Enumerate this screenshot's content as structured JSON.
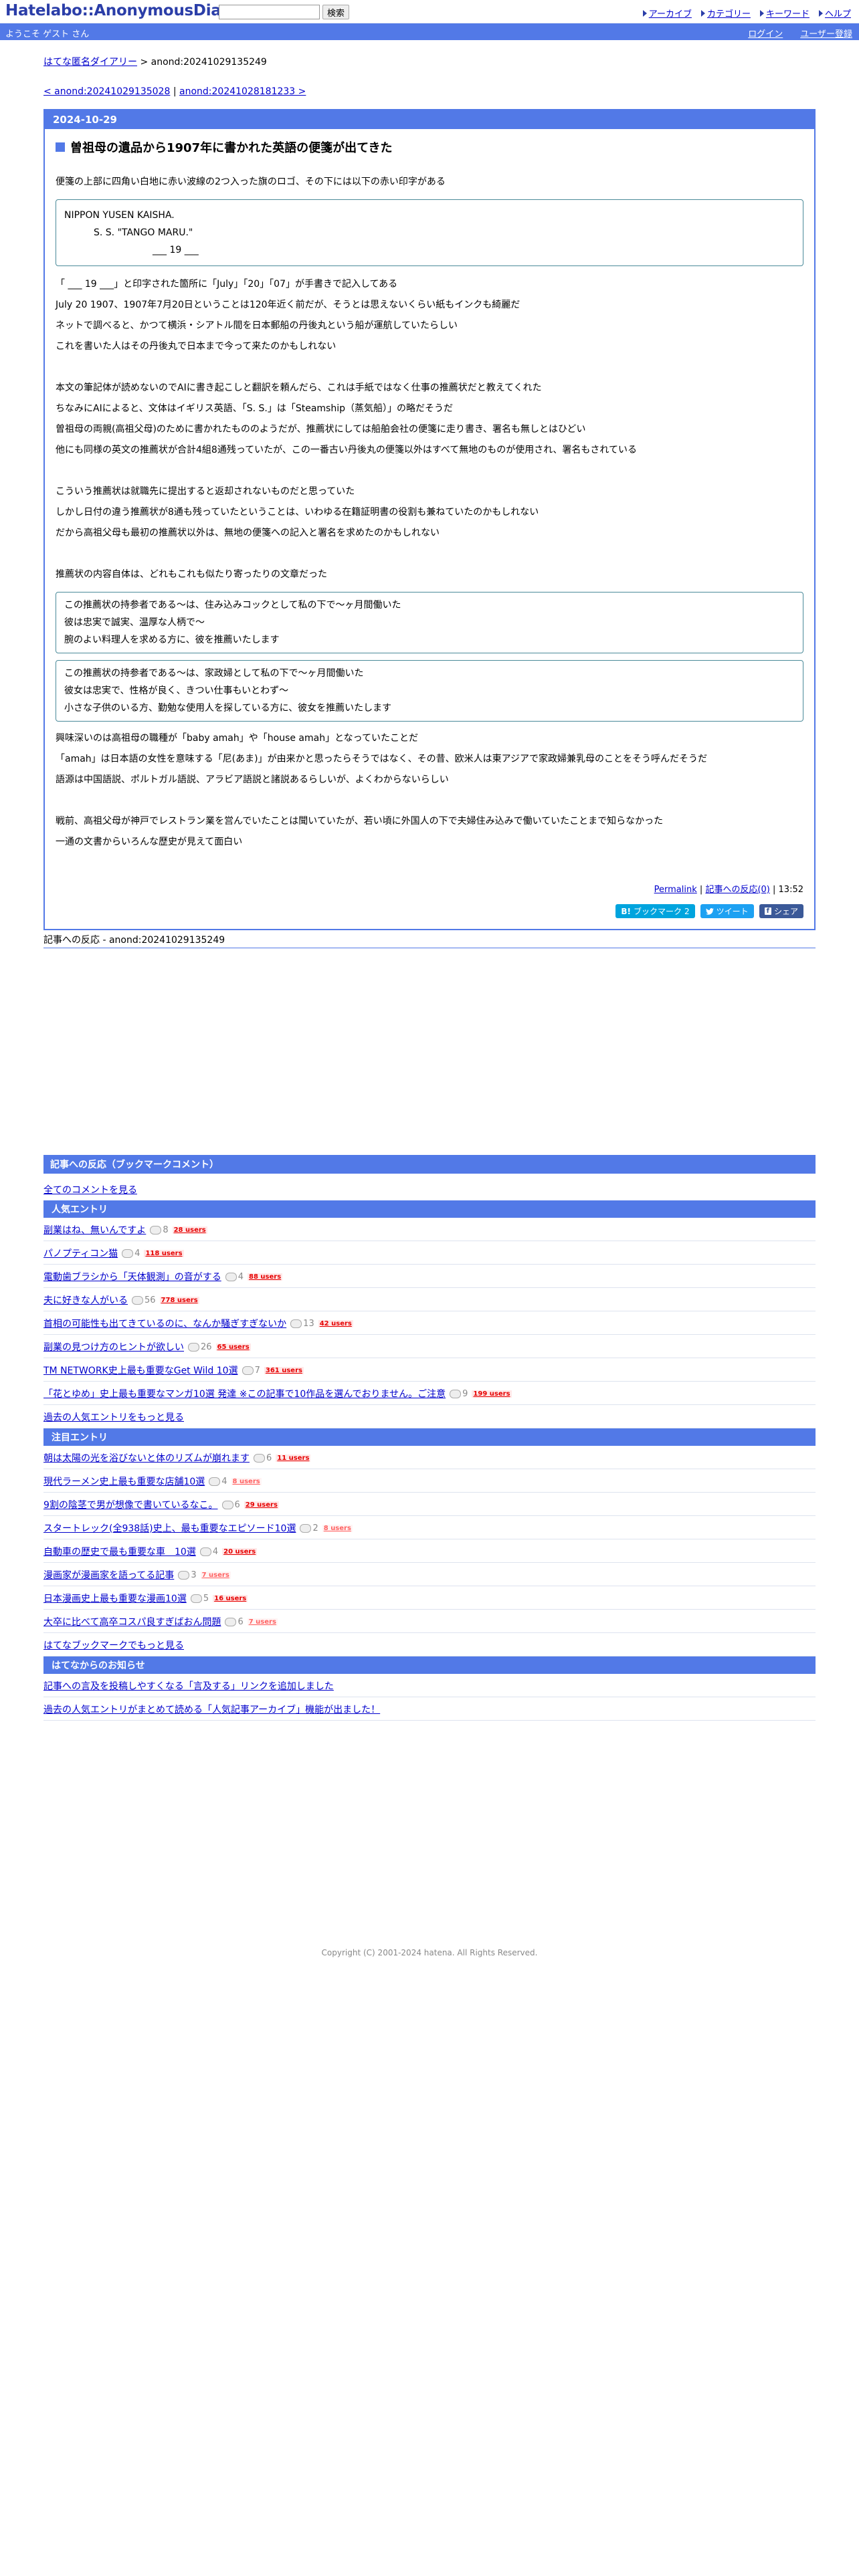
{
  "header": {
    "logo": "Hatelabo::AnonymousDiary",
    "search_placeholder": "",
    "search_button": "検索",
    "nav": [
      "アーカイブ",
      "カテゴリー",
      "キーワード",
      "ヘルプ"
    ]
  },
  "bar": {
    "welcome": "ようこそ ゲスト さん",
    "login": "ログイン",
    "register": "ユーザー登録"
  },
  "breadcrumb": {
    "home": "はてな匿名ダイアリー",
    "sep": " > ",
    "current": "anond:20241029135249"
  },
  "prevnext": {
    "prev": "< anond:20241029135028",
    "sep": " | ",
    "next": "anond:20241028181233 >"
  },
  "entry": {
    "date": "2024-10-29",
    "title": "曽祖母の遺品から1907年に書かれた英語の便箋が出てきた",
    "intro": "便箋の上部に四角い白地に赤い波線の2つ入った旗のロゴ、その下には以下の赤い印字がある",
    "printed": [
      "NIPPON YUSEN KAISHA.",
      "S. S. \"TANGO MARU.\"",
      "___ 19 ___"
    ],
    "p1": [
      "「 ___ 19 ___」と印字された箇所に「July」「20」「07」が手書きで記入してある",
      "July 20 1907、1907年7月20日ということは120年近く前だが、そうとは思えないくらい紙もインクも綺麗だ",
      "ネットで調べると、かつて横浜・シアトル間を日本郵船の丹後丸という船が運航していたらしい",
      "これを書いた人はその丹後丸で日本まで今って来たのかもしれない"
    ],
    "p2": [
      "本文の筆記体が読めないのでAIに書き起こしと翻訳を頼んだら、これは手紙ではなく仕事の推薦状だと教えてくれた",
      "ちなみにAIによると、文体はイギリス英語、「S. S.」は「Steamship（蒸気船）」の略だそうだ",
      "曽祖母の両親(高祖父母)のために書かれたもののようだが、推薦状にしては船舶会社の便箋に走り書き、署名も無しとはひどい",
      "他にも同様の英文の推薦状が合計4組8通残っていたが、この一番古い丹後丸の便箋以外はすべて無地のものが使用され、署名もされている"
    ],
    "p3": [
      "こういう推薦状は就職先に提出すると返却されないものだと思っていた",
      "しかし日付の違う推薦状が8通も残っていたということは、いわゆる在籍証明書の役割も兼ねていたのかもしれない",
      "だから高祖父母も最初の推薦状以外は、無地の便箋への記入と署名を求めたのかもしれない"
    ],
    "p4": "推薦状の内容自体は、どれもこれも似たり寄ったりの文章だった",
    "quote1": [
      "この推薦状の持参者である〜は、住み込みコックとして私の下で〜ヶ月間働いた",
      "彼は忠実で誠実、温厚な人柄で〜",
      "腕のよい料理人を求める方に、彼を推薦いたします"
    ],
    "quote2": [
      "この推薦状の持参者である〜は、家政婦として私の下で〜ヶ月間働いた",
      "彼女は忠実で、性格が良く、きつい仕事もいとわず〜",
      "小さな子供のいる方、勤勉な使用人を探している方に、彼女を推薦いたします"
    ],
    "p5": [
      "興味深いのは高祖母の職種が「baby amah」や「house amah」となっていたことだ",
      "「amah」は日本語の女性を意味する「尼(あま)」が由来かと思ったらそうではなく、その昔、欧米人は東アジアで家政婦兼乳母のことをそう呼んだそうだ",
      "語源は中国語説、ポルトガル語説、アラビア語説と諸説あるらしいが、よくわからないらしい"
    ],
    "p6": [
      "戦前、高祖父母が神戸でレストラン業を営んでいたことは聞いていたが、若い頃に外国人の下で夫婦住み込みで働いていたことまで知らなかった",
      "一通の文書からいろんな歴史が見えて面白い"
    ],
    "permalink": "Permalink",
    "reaction_link": "記事への反応(0)",
    "time": "13:52",
    "share": {
      "hatebu": "ブックマーク",
      "hatebu_count": "2",
      "tweet": "ツイート",
      "facebook": "シェア"
    }
  },
  "reaction_title": "記事への反応 - anond:20241029135249",
  "bookmark_section": {
    "title": "記事への反応（ブックマークコメント）",
    "all_comments": "全てのコメントを見る"
  },
  "popular": {
    "title": "人気エントリ",
    "items": [
      {
        "title": "副業はね、無いんですよ",
        "count": "8",
        "users": "28 users"
      },
      {
        "title": "パノプティコン猫",
        "count": "4",
        "users": "118 users"
      },
      {
        "title": "電動歯ブラシから「天体観測」の音がする",
        "count": "4",
        "users": "88 users"
      },
      {
        "title": "夫に好きな人がいる",
        "count": "56",
        "users": "778 users"
      },
      {
        "title": "首相の可能性も出てきているのに、なんか騒ぎすぎないか",
        "count": "13",
        "users": "42 users"
      },
      {
        "title": "副業の見つけ方のヒントが欲しい",
        "count": "26",
        "users": "65 users"
      },
      {
        "title": "TM NETWORK史上最も重要なGet Wild 10選",
        "count": "7",
        "users": "361 users"
      },
      {
        "title": "「花とゆめ」史上最も重要なマンガ10選 発達 ※この記事で10作品を選んでおりません。ご注意",
        "count": "9",
        "users": "199 users"
      }
    ],
    "more": "過去の人気エントリをもっと見る"
  },
  "notable": {
    "title": "注目エントリ",
    "items": [
      {
        "title": "朝は太陽の光を浴びないと体のリズムが崩れます",
        "count": "6",
        "users": "11 users",
        "lite": false
      },
      {
        "title": "現代ラーメン史上最も重要な店舗10選",
        "count": "4",
        "users": "8 users",
        "lite": true
      },
      {
        "title": "9割の陰茎で男が想像で書いているなこ。",
        "count": "6",
        "users": "29 users",
        "lite": false
      },
      {
        "title": "スタートレック(全938話)史上、最も重要なエピソード10選",
        "count": "2",
        "users": "8 users",
        "lite": true
      },
      {
        "title": "自動車の歴史で最も重要な車　10選",
        "count": "4",
        "users": "20 users",
        "lite": false
      },
      {
        "title": "漫画家が漫画家を語ってる記事",
        "count": "3",
        "users": "7 users",
        "lite": true
      },
      {
        "title": "日本漫画史上最も重要な漫画10選",
        "count": "5",
        "users": "16 users",
        "lite": false
      },
      {
        "title": "大卒に比べて高卒コスパ良すぎばおん問題",
        "count": "6",
        "users": "7 users",
        "lite": true
      }
    ],
    "more": "はてなブックマークでもっと見る"
  },
  "notice": {
    "title": "はてなからのお知らせ",
    "items": [
      "記事への言及を投稿しやすくなる「言及する」リンクを追加しました",
      "過去の人気エントリがまとめて読める「人気記事アーカイブ」機能が出ました！"
    ]
  },
  "copyright": "Copyright (C) 2001-2024 hatena. All Rights Reserved."
}
